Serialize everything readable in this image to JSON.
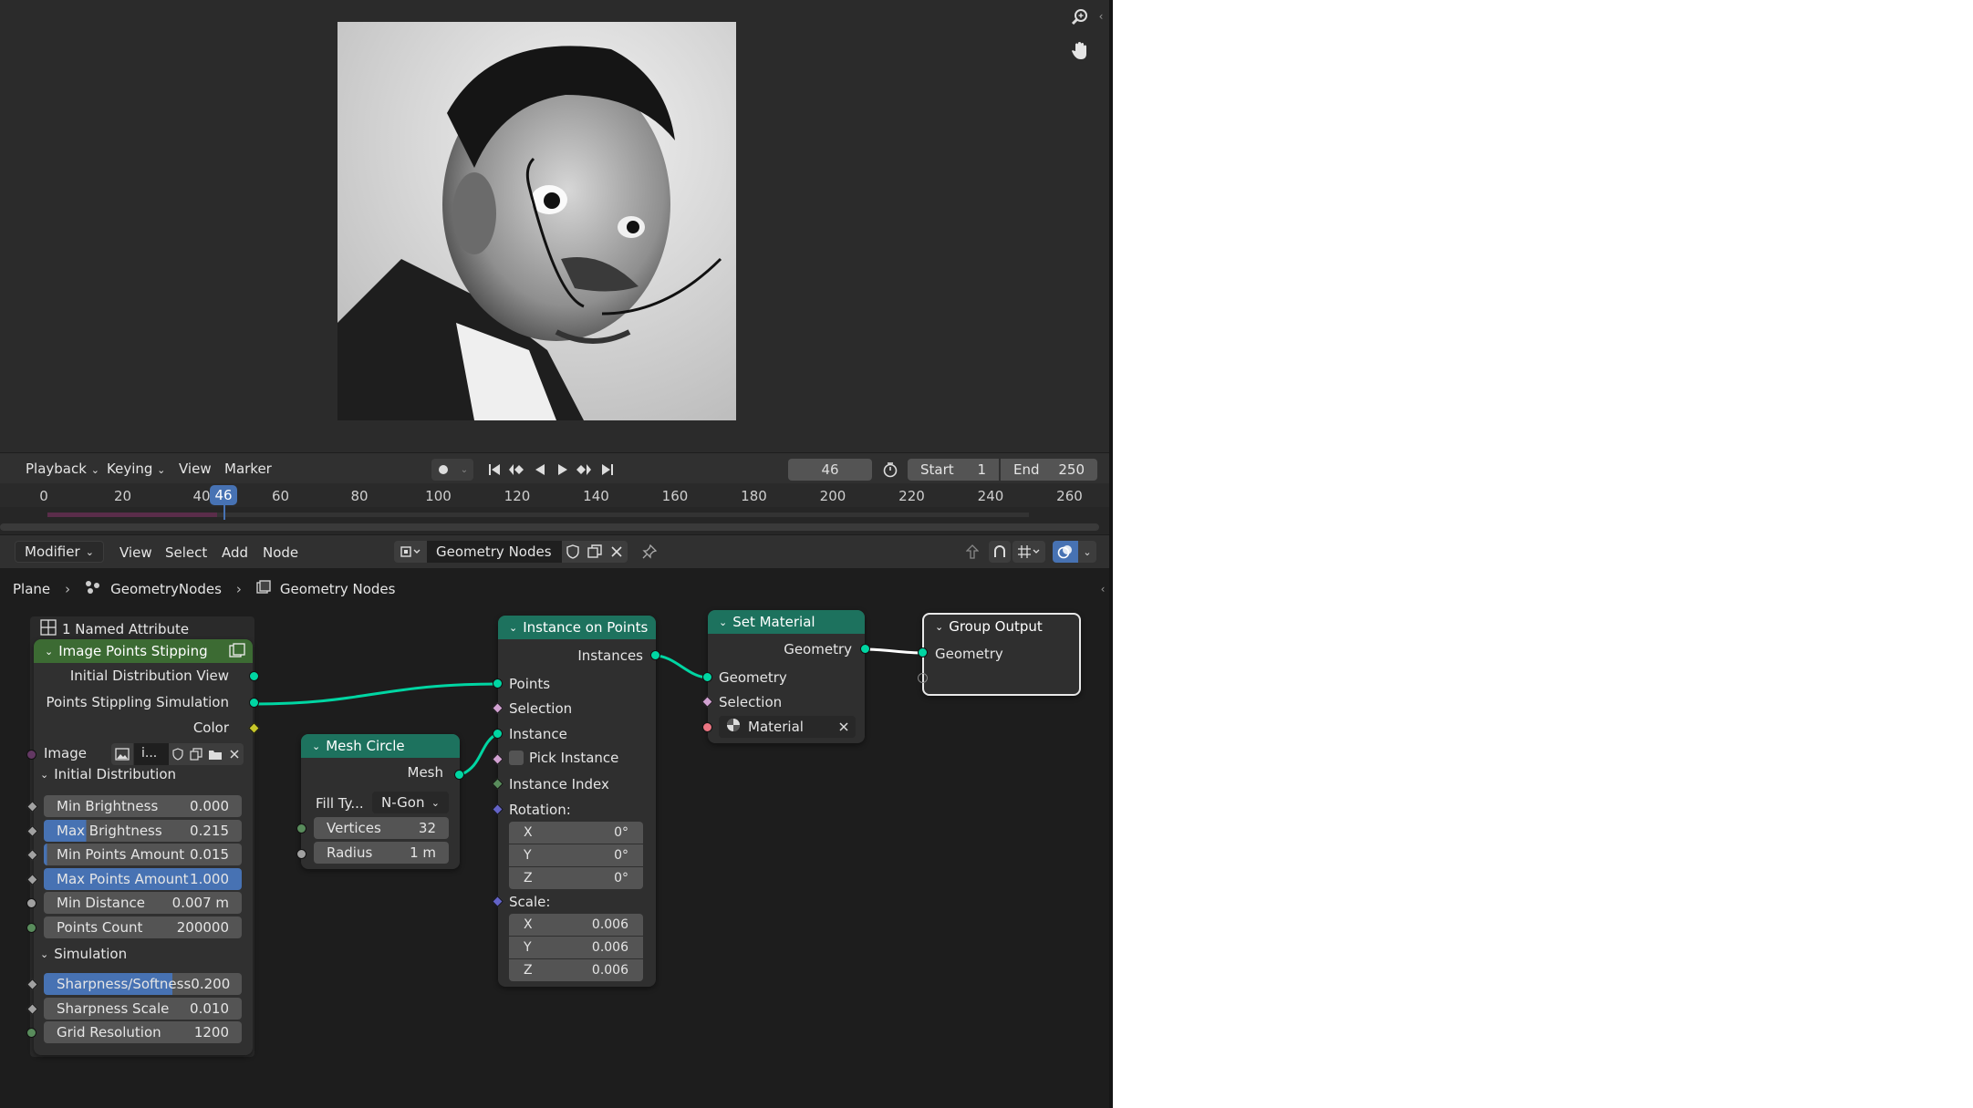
{
  "timeline_menu": {
    "playback": "Playback",
    "keying": "Keying",
    "view": "View",
    "marker": "Marker"
  },
  "timeline": {
    "current_frame": "46",
    "start_label": "Start",
    "start_value": "1",
    "end_label": "End",
    "end_value": "250",
    "ticks": [
      "0",
      "20",
      "40",
      "60",
      "80",
      "100",
      "120",
      "140",
      "160",
      "180",
      "200",
      "220",
      "240",
      "260"
    ]
  },
  "node_header": {
    "editor_type": "Modifier",
    "view": "View",
    "select": "Select",
    "add": "Add",
    "node": "Node",
    "tree_name": "Geometry Nodes"
  },
  "breadcrumb": {
    "object": "Plane",
    "modifier": "GeometryNodes",
    "tree": "Geometry Nodes"
  },
  "frame_label": "1 Named Attribute",
  "image_points_stipping": {
    "title": "Image Points Stipping",
    "outputs": [
      "Initial Distribution View",
      "Points Stippling Simulation",
      "Color"
    ],
    "image_label": "Image",
    "image_name": "i...",
    "initial_distribution_label": "Initial Distribution",
    "initial_fields": [
      {
        "label": "Min Brightness",
        "value": "0.000",
        "fill": 0
      },
      {
        "label": "Max Brightness",
        "value": "0.215",
        "fill": 0.215
      },
      {
        "label": "Min Points Amount",
        "value": "0.015",
        "fill": 0.015
      },
      {
        "label": "Max Points Amount",
        "value": "1.000",
        "fill": 1
      },
      {
        "label": "Min Distance",
        "value": "0.007 m",
        "fill": 0
      },
      {
        "label": "Points Count",
        "value": "200000",
        "fill": 0
      }
    ],
    "simulation_label": "Simulation",
    "simulation_fields": [
      {
        "label": "Sharpness/Softness",
        "value": "0.200",
        "fill": 0.65
      },
      {
        "label": "Sharpness Scale",
        "value": "0.010",
        "fill": 0
      },
      {
        "label": "Grid Resolution",
        "value": "1200",
        "fill": 0
      }
    ]
  },
  "mesh_circle": {
    "title": "Mesh Circle",
    "output": "Mesh",
    "fill_type_label": "Fill Ty...",
    "fill_type_value": "N-Gon",
    "vertices_label": "Vertices",
    "vertices_value": "32",
    "radius_label": "Radius",
    "radius_value": "1 m"
  },
  "instance_on_points": {
    "title": "Instance on Points",
    "output": "Instances",
    "inputs": [
      "Points",
      "Selection",
      "Instance"
    ],
    "pick_instance": "Pick Instance",
    "instance_index": "Instance Index",
    "rotation_label": "Rotation:",
    "rotation": [
      {
        "axis": "X",
        "value": "0°"
      },
      {
        "axis": "Y",
        "value": "0°"
      },
      {
        "axis": "Z",
        "value": "0°"
      }
    ],
    "scale_label": "Scale:",
    "scale": [
      {
        "axis": "X",
        "value": "0.006"
      },
      {
        "axis": "Y",
        "value": "0.006"
      },
      {
        "axis": "Z",
        "value": "0.006"
      }
    ]
  },
  "set_material": {
    "title": "Set Material",
    "output": "Geometry",
    "inputs": [
      "Geometry",
      "Selection"
    ],
    "material_label": "Material"
  },
  "group_output": {
    "title": "Group Output",
    "input": "Geometry"
  },
  "colors": {
    "geometry_socket": "#00d6a3",
    "shader_header": "#1d725e",
    "attribute_header": "#3c6b33",
    "accent": "#4772b3",
    "playhead": "#4772b3"
  },
  "icons": [
    "zoom-icon",
    "hand-icon",
    "record-icon",
    "jump-start-icon",
    "prev-keyframe-icon",
    "play-reverse-icon",
    "play-icon",
    "next-keyframe-icon",
    "jump-end-icon",
    "stopwatch-icon",
    "pin-icon",
    "shield-icon",
    "copy-icon",
    "close-icon",
    "overlay-icon",
    "folder-icon",
    "image-icon",
    "material-icon"
  ]
}
